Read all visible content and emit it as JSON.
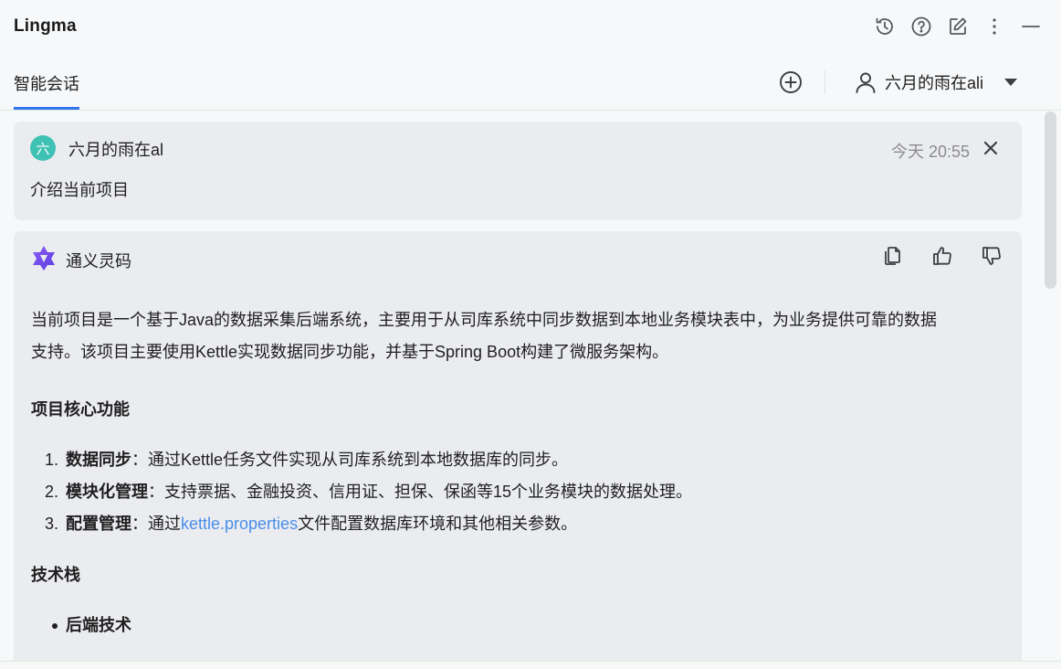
{
  "app": {
    "title": "Lingma"
  },
  "title_actions": [
    {
      "icon": "history-icon"
    },
    {
      "icon": "help-icon"
    },
    {
      "icon": "edit-icon"
    },
    {
      "icon": "more-vertical-icon"
    },
    {
      "icon": "minimize-icon"
    }
  ],
  "tabs": {
    "active_label": "智能会话"
  },
  "user_menu": {
    "name": "六月的雨在ali"
  },
  "colors": {
    "accent": "#3574f0",
    "avatar": "#3ec2b4",
    "link": "#4a8ee8",
    "card": "#ebecf0"
  },
  "user_message": {
    "avatar_char": "六",
    "name": "六月的雨在al",
    "time": "今天 20:55",
    "text": "介绍当前项目"
  },
  "ai_message": {
    "name": "通义灵码",
    "intro_line1": "当前项目是一个基于Java的数据采集后端系统，主要用于从司库系统中同步数据到本地业务模块表中，为业务提供可靠的数据",
    "intro_line2": "支持。该项目主要使用Kettle实现数据同步功能，并基于Spring Boot构建了微服务架构。",
    "features_heading": "项目核心功能",
    "features": [
      {
        "num": "1.",
        "title": "数据同步",
        "sep": "：",
        "text": "通过Kettle任务文件实现从司库系统到本地数据库的同步。"
      },
      {
        "num": "2.",
        "title": "模块化管理",
        "sep": "：",
        "text": "支持票据、金融投资、信用证、担保、保函等15个业务模块的数据处理。"
      },
      {
        "num": "3.",
        "title": "配置管理",
        "sep": "：",
        "pre": "通过",
        "link": "kettle.properties",
        "post": "文件配置数据库环境和其他相关参数。"
      }
    ],
    "tech_heading": "技术栈",
    "tech_items": [
      "后端技术"
    ]
  }
}
